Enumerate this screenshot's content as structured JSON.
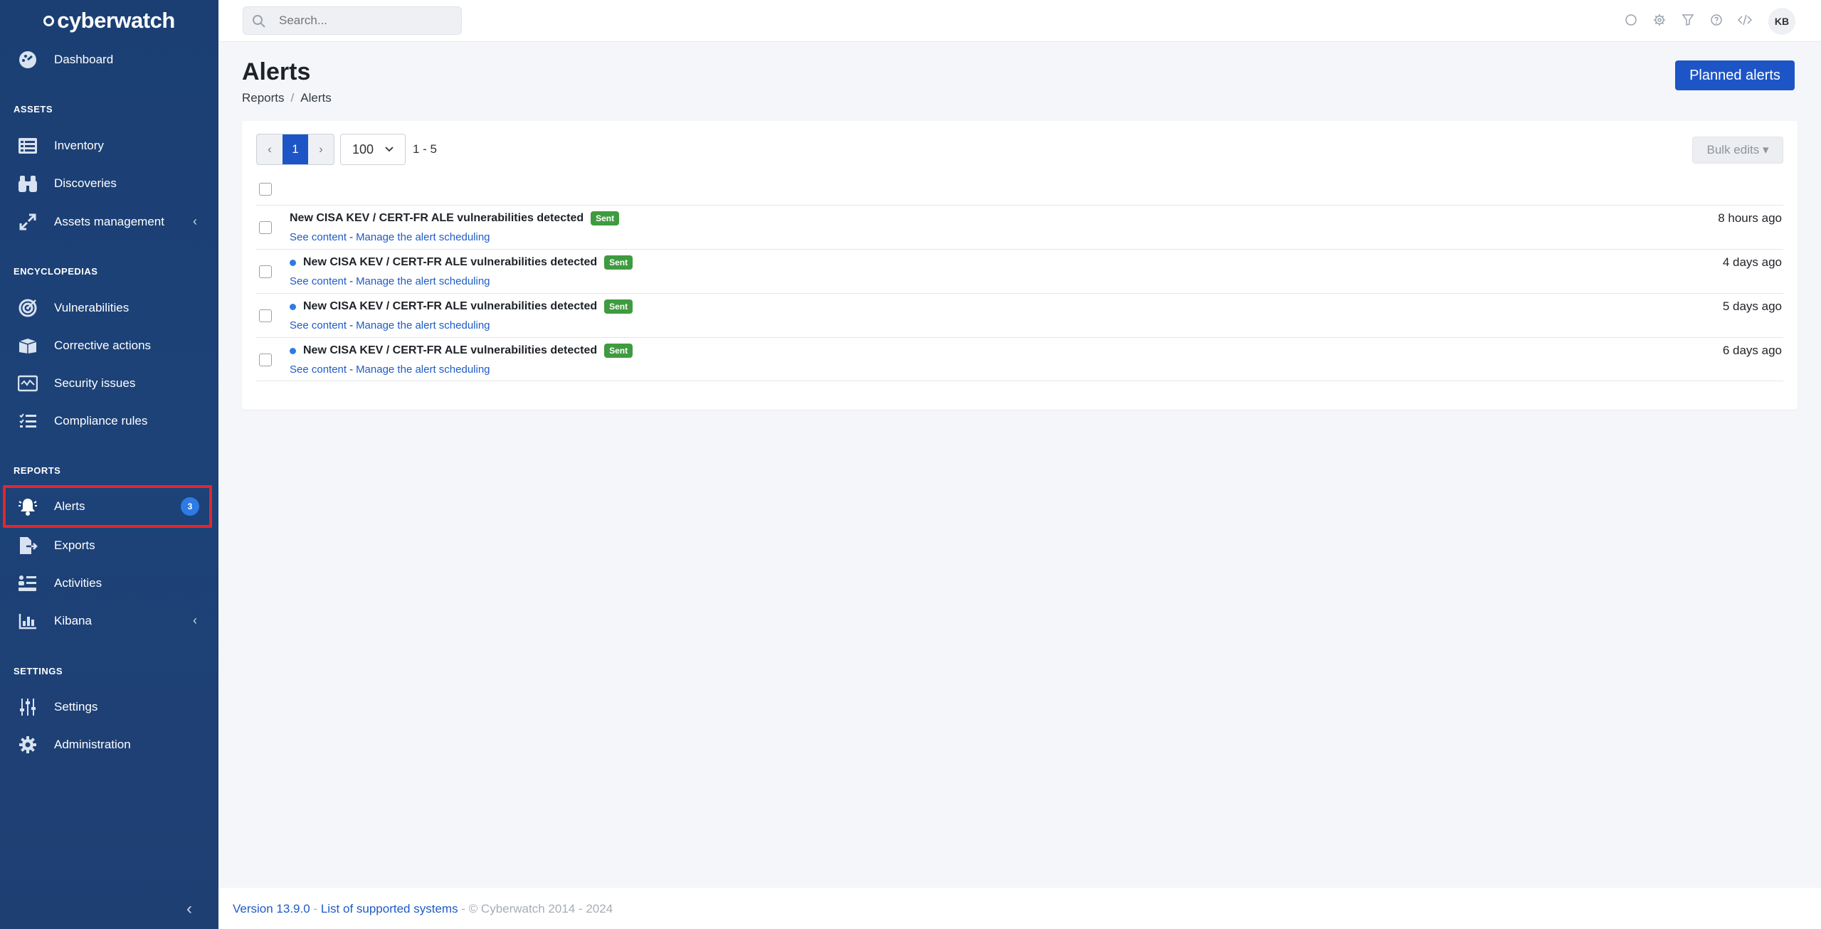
{
  "brand": {
    "name": "cyberwatch"
  },
  "search": {
    "placeholder": "Search..."
  },
  "user": {
    "initials": "KB"
  },
  "sidebar": {
    "dashboard": "Dashboard",
    "sections": {
      "assets": "ASSETS",
      "encyclopedias": "ENCYCLOPEDIAS",
      "reports": "REPORTS",
      "settings": "SETTINGS"
    },
    "items": {
      "inventory": "Inventory",
      "discoveries": "Discoveries",
      "assets_management": "Assets management",
      "vulnerabilities": "Vulnerabilities",
      "corrective_actions": "Corrective actions",
      "security_issues": "Security issues",
      "compliance_rules": "Compliance rules",
      "alerts": "Alerts",
      "exports": "Exports",
      "activities": "Activities",
      "kibana": "Kibana",
      "settings": "Settings",
      "administration": "Administration"
    },
    "alerts_badge": "3",
    "collapse_glyph": "‹",
    "expand_glyph": "‹"
  },
  "page": {
    "title": "Alerts",
    "breadcrumb": [
      "Reports",
      "Alerts"
    ],
    "breadcrumb_sep": "/",
    "planned_button": "Planned alerts"
  },
  "toolbar": {
    "prev": "‹",
    "current_page": "1",
    "next": "›",
    "per_page": "100",
    "range": "1 - 5",
    "bulk_edits": "Bulk edits ▾"
  },
  "alerts": [
    {
      "title": "New CISA KEV / CERT-FR ALE vulnerabilities detected",
      "status": "Sent",
      "see": "See content",
      "dash": "-",
      "manage": "Manage the alert scheduling",
      "time": "8 hours ago",
      "unread": false
    },
    {
      "title": "New CISA KEV / CERT-FR ALE vulnerabilities detected",
      "status": "Sent",
      "see": "See content",
      "dash": "-",
      "manage": "Manage the alert scheduling",
      "time": "4 days ago",
      "unread": true
    },
    {
      "title": "New CISA KEV / CERT-FR ALE vulnerabilities detected",
      "status": "Sent",
      "see": "See content",
      "dash": "-",
      "manage": "Manage the alert scheduling",
      "time": "5 days ago",
      "unread": true
    },
    {
      "title": "New CISA KEV / CERT-FR ALE vulnerabilities detected",
      "status": "Sent",
      "see": "See content",
      "dash": "-",
      "manage": "Manage the alert scheduling",
      "time": "6 days ago",
      "unread": true
    }
  ],
  "footer": {
    "version": "Version 13.9.0",
    "sep1": " - ",
    "supported": "List of supported systems",
    "copyright": " - © Cyberwatch 2014 - 2024"
  },
  "colors": {
    "sidebar_bg": "#1d4278",
    "accent": "#1e55c6",
    "sent_badge": "#3f9b3f",
    "highlight": "#e3262b"
  }
}
